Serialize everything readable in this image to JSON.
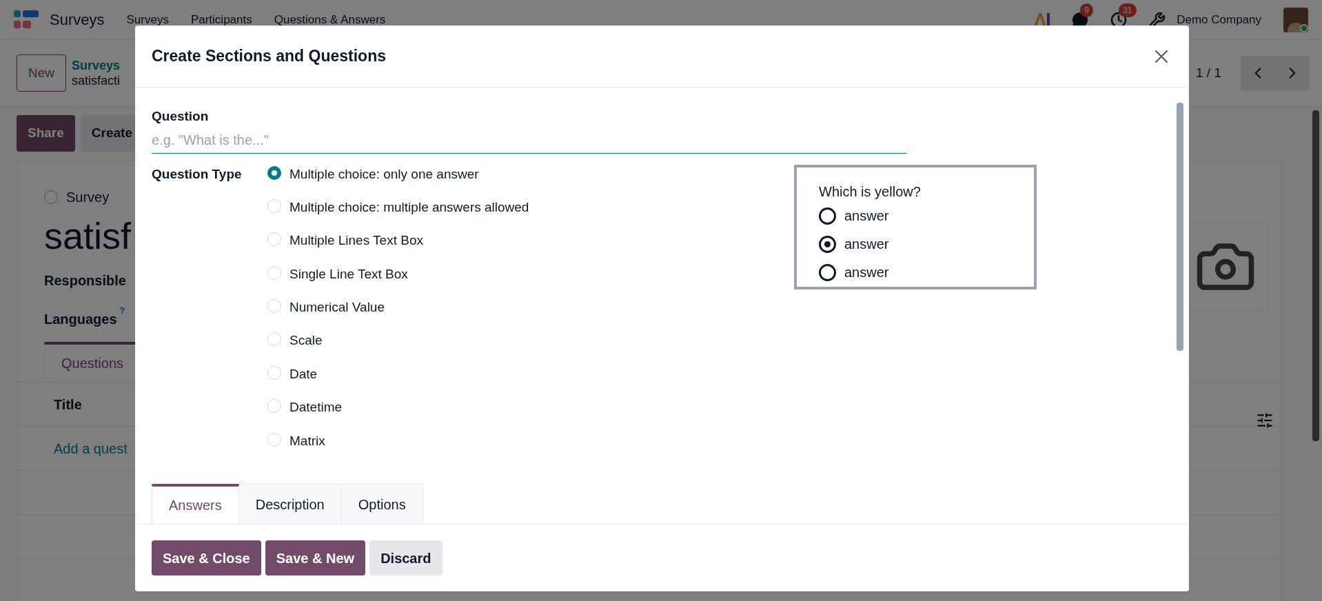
{
  "navbar": {
    "app_name": "Surveys",
    "menu": [
      "Surveys",
      "Participants",
      "Questions & Answers"
    ],
    "badges": [
      {
        "count": "9"
      },
      {
        "count": "31"
      }
    ],
    "company": "Demo Company"
  },
  "control_panel": {
    "new_button": "New",
    "breadcrumb": "Surveys",
    "record": "satisfacti",
    "pager": "1 / 1"
  },
  "actions": [
    "Share",
    "Create"
  ],
  "form": {
    "survey_type": {
      "label": "Survey",
      "selected": false
    },
    "title": "satisf",
    "fields": [
      {
        "label": "Responsible"
      },
      {
        "label": "Languages",
        "help": "?"
      }
    ],
    "tab": {
      "label": "Questions",
      "selected": true
    },
    "list_header": "Title",
    "add_row": "Add a quest"
  },
  "dialog": {
    "title": "Create Sections and Questions",
    "question_label": "Question",
    "question_placeholder": "e.g. \"What is the...\"",
    "type_label": "Question Type",
    "types": [
      {
        "label": "Multiple choice: only one answer",
        "selected": true
      },
      {
        "label": "Multiple choice: multiple answers allowed",
        "selected": false
      },
      {
        "label": "Multiple Lines Text Box",
        "selected": false
      },
      {
        "label": "Single Line Text Box",
        "selected": false
      },
      {
        "label": "Numerical Value",
        "selected": false
      },
      {
        "label": "Scale",
        "selected": false
      },
      {
        "label": "Date",
        "selected": false
      },
      {
        "label": "Datetime",
        "selected": false
      },
      {
        "label": "Matrix",
        "selected": false
      }
    ],
    "preview": {
      "question": "Which is yellow?",
      "answers": [
        {
          "label": "answer",
          "selected": false
        },
        {
          "label": "answer",
          "selected": true
        },
        {
          "label": "answer",
          "selected": false
        }
      ]
    },
    "tabs": [
      {
        "label": "Answers",
        "selected": true
      },
      {
        "label": "Description",
        "selected": false
      },
      {
        "label": "Options",
        "selected": false
      }
    ],
    "buttons": [
      {
        "label": "Save & Close",
        "kind": "primary"
      },
      {
        "label": "Save & New",
        "kind": "primary"
      },
      {
        "label": "Discard",
        "kind": "secondary"
      }
    ]
  }
}
